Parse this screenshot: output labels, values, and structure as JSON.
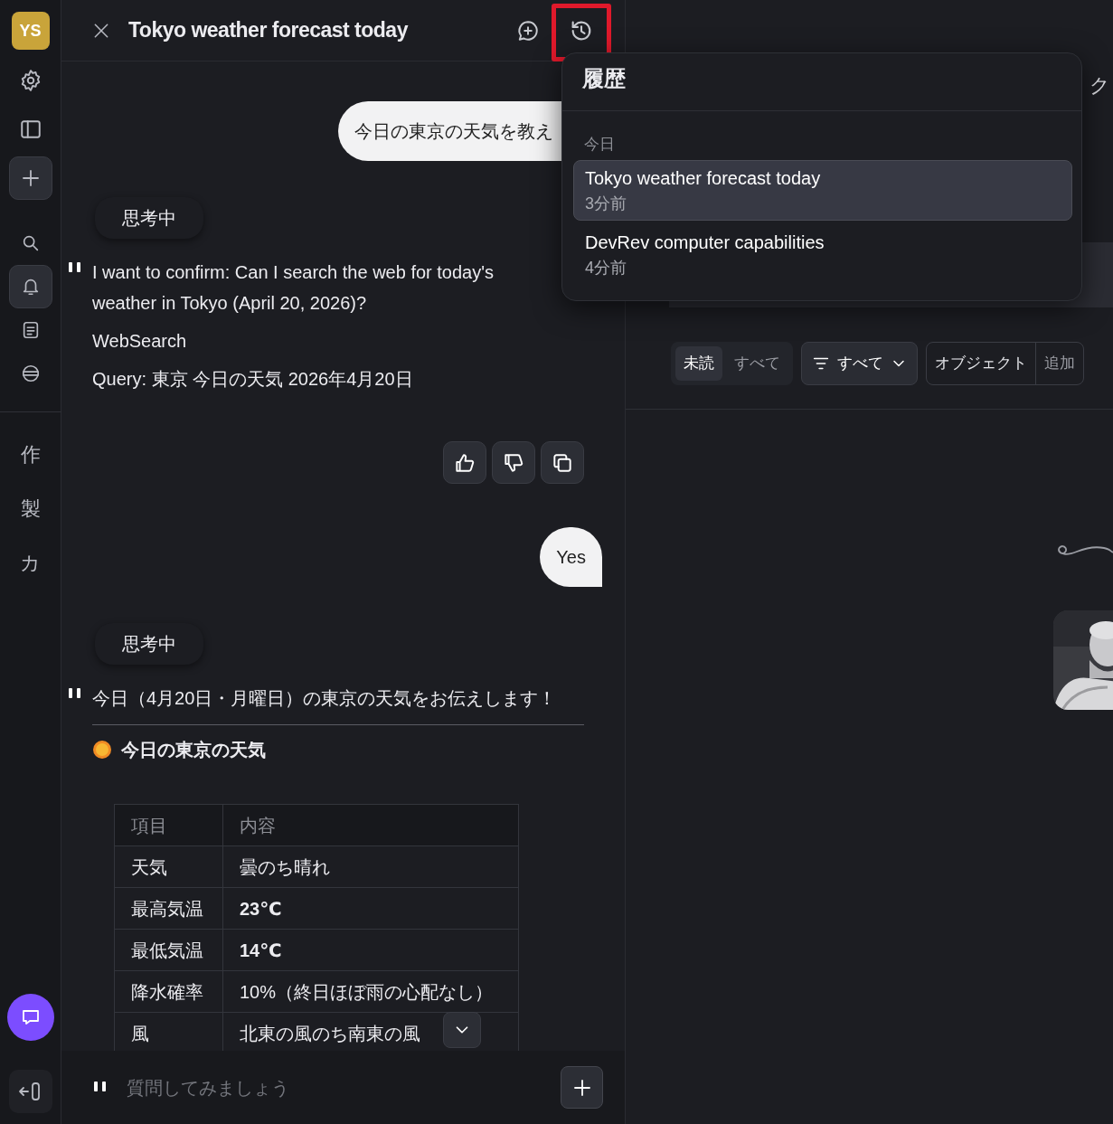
{
  "rail": {
    "avatar": "YS",
    "top_icons": [
      {
        "kind": "settings"
      },
      {
        "kind": "sidebar"
      },
      {
        "kind": "new"
      }
    ],
    "nav": [
      {
        "kind": "search",
        "selected": false
      },
      {
        "kind": "bell",
        "selected": true
      },
      {
        "kind": "notes",
        "selected": false
      },
      {
        "kind": "globe",
        "selected": false
      }
    ],
    "shortcuts": [
      "作",
      "製",
      "カ"
    ],
    "bottom_icons": [
      {
        "kind": "chat"
      },
      {
        "kind": "exit"
      }
    ]
  },
  "chat": {
    "title": "Tokyo weather forecast today",
    "history_highlighted": true,
    "messages": [
      {
        "kind": "user",
        "text": "今日の東京の天気を教え"
      },
      {
        "kind": "thinking",
        "text": "思考中"
      },
      {
        "kind": "assistant",
        "paragraphs": [
          "I want to confirm: Can I search the web for today's weather in Tokyo (April 20, 2026)?",
          "WebSearch",
          "Query: 東京 今日の天気 2026年4月20日"
        ],
        "feedback": true
      },
      {
        "kind": "user",
        "text": "Yes"
      },
      {
        "kind": "thinking",
        "text": "思考中"
      },
      {
        "kind": "assistant",
        "paragraphs": [
          "今日（4月20日・月曜日）の東京の天気をお伝えします！"
        ],
        "rule": true,
        "heading": "今日の東京の天気",
        "table": {
          "columns": [
            "項目",
            "内容"
          ],
          "rows": [
            [
              "天気",
              "曇のち晴れ"
            ],
            [
              "最高気温",
              "**23℃**"
            ],
            [
              "最低気温",
              "**14℃**"
            ],
            [
              "降水確率",
              "10%（終日ほぼ雨の心配なし）"
            ],
            [
              "風",
              "北東の風のち南東の風"
            ]
          ]
        }
      }
    ],
    "composer": {
      "placeholder": "質問してみましょう"
    }
  },
  "history": {
    "title": "履歴",
    "group": "今日",
    "items": [
      {
        "title": "Tokyo weather forecast today",
        "time": "3分前",
        "selected": true
      },
      {
        "title": "DevRev computer capabilities",
        "time": "4分前",
        "selected": false
      }
    ]
  },
  "right": {
    "cut_text": "ク",
    "read_filter": [
      {
        "label": "未読",
        "selected": true
      },
      {
        "label": "すべて",
        "selected": false
      }
    ],
    "filter_button": "すべて",
    "object_buttons": [
      "オブジェクト",
      "追加"
    ],
    "picture": {
      "kind": "picture"
    }
  }
}
